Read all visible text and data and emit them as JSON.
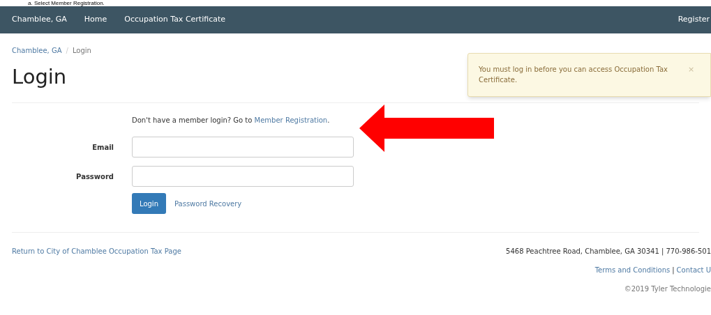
{
  "caption": "a.   Select Member Registration.",
  "navbar": {
    "brand": "Chamblee, GA",
    "links": [
      "Home",
      "Occupation Tax Certificate"
    ],
    "right_link": "Register"
  },
  "breadcrumb": [
    {
      "label": "Chamblee, GA",
      "kind": "link"
    },
    {
      "label": "Login",
      "kind": "current"
    }
  ],
  "breadcrumb_separator": "/",
  "page_title": "Login",
  "alert": {
    "message": "You must log in before you can access Occupation Tax Certificate.",
    "close": "×"
  },
  "registration_prompt": {
    "text": "Don't have a member login? Go to",
    "link": "Member Registration",
    "end": "."
  },
  "fields": [
    {
      "label": "Email"
    },
    {
      "label": "Password"
    }
  ],
  "login_button": "Login",
  "password_recovery": "Password Recovery",
  "footer": {
    "return_link": "Return to City of Chamblee Occupation Tax Page",
    "address": "5468 Peachtree Road, Chamblee, GA 30341 | 770-986-501",
    "links": [
      "Terms and Conditions",
      "Contact U"
    ],
    "link_separator": "|",
    "copyright": "©2019 Tyler Technologie"
  }
}
